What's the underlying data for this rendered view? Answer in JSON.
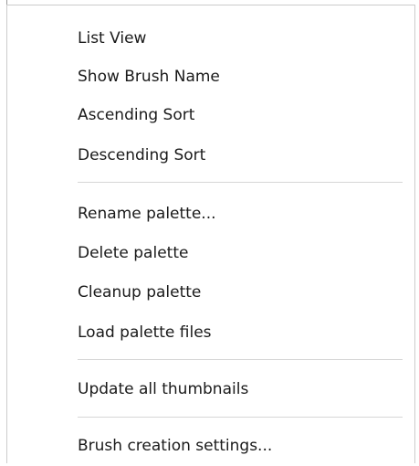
{
  "menu": {
    "group_view": {
      "list_view": "List View",
      "show_brush_name": "Show Brush Name",
      "ascending_sort": "Ascending Sort",
      "descending_sort": "Descending Sort"
    },
    "group_palette": {
      "rename_palette": "Rename palette...",
      "delete_palette": "Delete palette",
      "cleanup_palette": "Cleanup palette",
      "load_palette_files": "Load palette files"
    },
    "group_thumbnails": {
      "update_all_thumbnails": "Update all thumbnails"
    },
    "group_settings": {
      "brush_creation_settings": "Brush creation settings..."
    }
  }
}
